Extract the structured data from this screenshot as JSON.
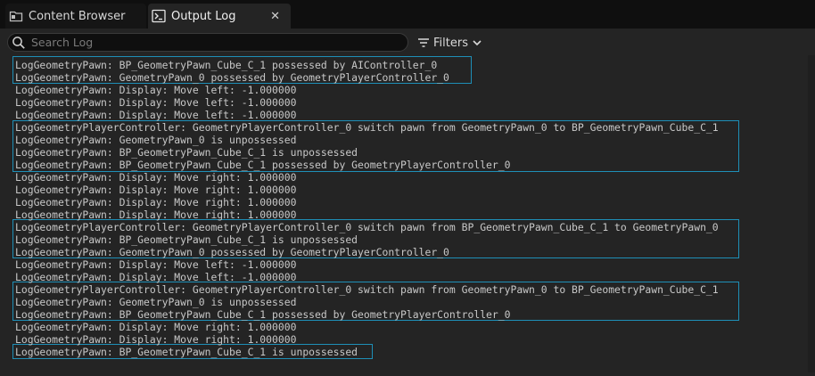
{
  "tabs": [
    {
      "label": "Content Browser",
      "icon": "folder-icon"
    },
    {
      "label": "Output Log",
      "icon": "terminal-icon",
      "close": "✕"
    }
  ],
  "toolbar": {
    "search_placeholder": "Search Log",
    "filters_label": "Filters"
  },
  "colors": {
    "highlight": "#1e8fb7",
    "log_text": "#c8c8c8",
    "background": "#242424"
  },
  "log": {
    "lines": [
      "LogGeometryPawn: BP_GeometryPawn_Cube_C_1 possessed by AIController_0",
      "LogGeometryPawn: GeometryPawn_0 possessed by GeometryPlayerController_0",
      "LogGeometryPawn: Display: Move left: -1.000000",
      "LogGeometryPawn: Display: Move left: -1.000000",
      "LogGeometryPawn: Display: Move left: -1.000000",
      "LogGeometryPlayerController: GeometryPlayerController_0 switch pawn from GeometryPawn_0 to BP_GeometryPawn_Cube_C_1",
      "LogGeometryPawn: GeometryPawn_0 is unpossessed",
      "LogGeometryPawn: BP_GeometryPawn_Cube_C_1 is unpossessed",
      "LogGeometryPawn: BP_GeometryPawn_Cube_C_1 possessed by GeometryPlayerController_0",
      "LogGeometryPawn: Display: Move right: 1.000000",
      "LogGeometryPawn: Display: Move right: 1.000000",
      "LogGeometryPawn: Display: Move right: 1.000000",
      "LogGeometryPawn: Display: Move right: 1.000000",
      "LogGeometryPlayerController: GeometryPlayerController_0 switch pawn from BP_GeometryPawn_Cube_C_1 to GeometryPawn_0",
      "LogGeometryPawn: BP_GeometryPawn_Cube_C_1 is unpossessed",
      "LogGeometryPawn: GeometryPawn_0 possessed by GeometryPlayerController_0",
      "LogGeometryPawn: Display: Move left: -1.000000",
      "LogGeometryPawn: Display: Move left: -1.000000",
      "LogGeometryPlayerController: GeometryPlayerController_0 switch pawn from GeometryPawn_0 to BP_GeometryPawn_Cube_C_1",
      "LogGeometryPawn: GeometryPawn_0 is unpossessed",
      "LogGeometryPawn: BP_GeometryPawn_Cube_C_1 possessed by GeometryPlayerController_0",
      "LogGeometryPawn: Display: Move right: 1.000000",
      "LogGeometryPawn: Display: Move right: 1.000000",
      "LogGeometryPawn: BP_GeometryPawn_Cube_C_1 is unpossessed"
    ]
  }
}
